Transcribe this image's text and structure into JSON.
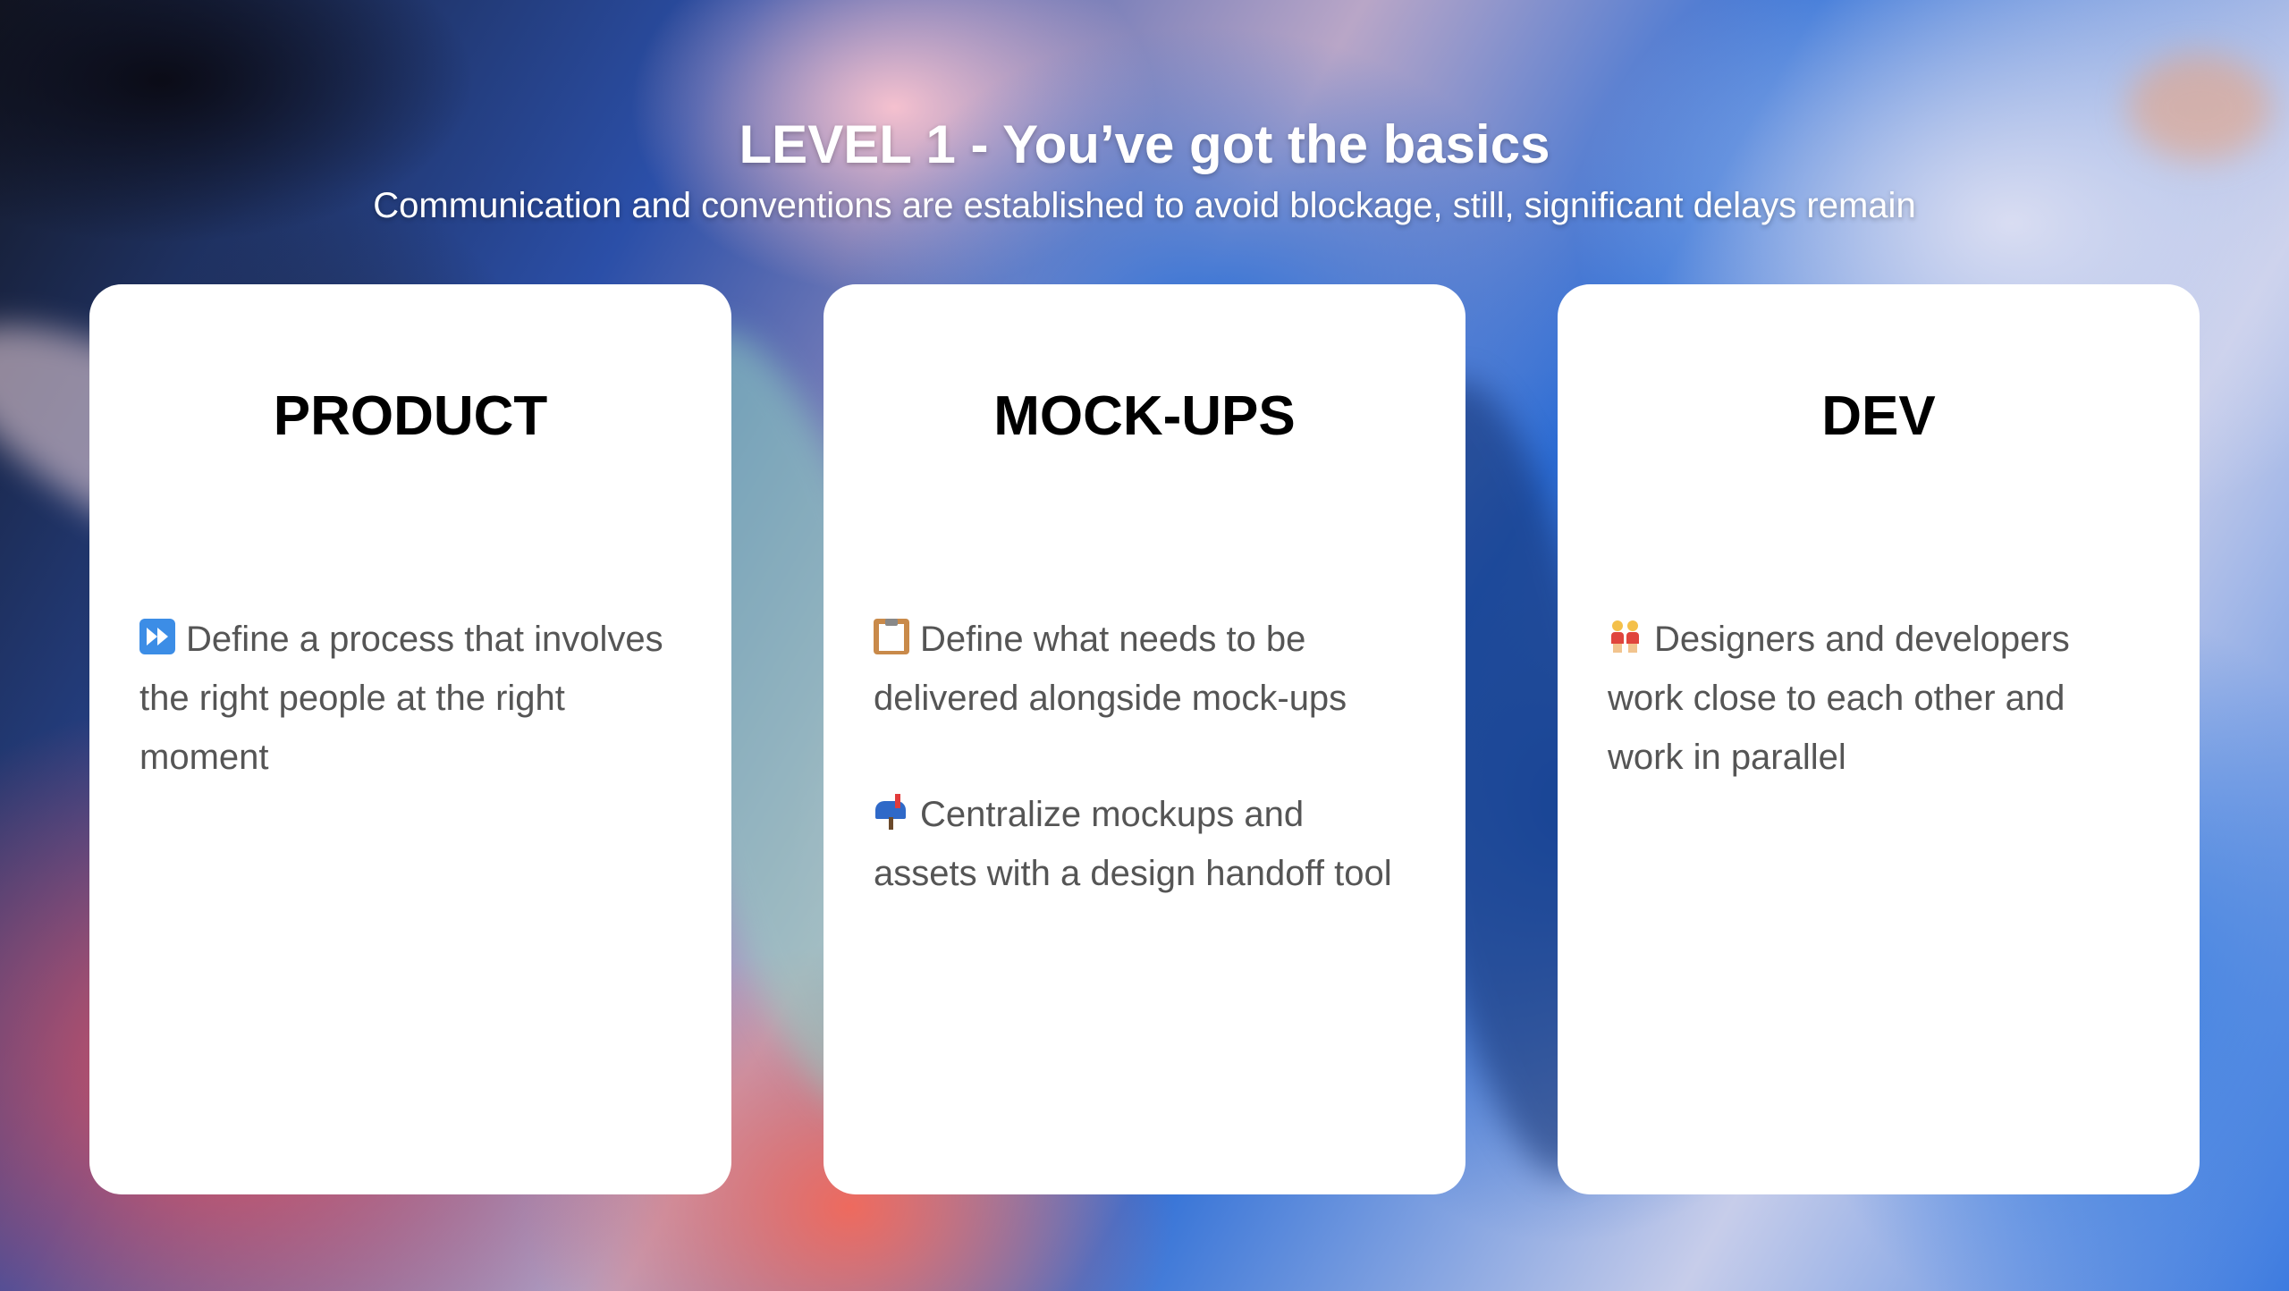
{
  "header": {
    "title": "LEVEL 1 - You’ve got the basics",
    "subtitle": "Communication and conventions are established to avoid blockage, still, significant delays remain"
  },
  "cards": [
    {
      "title": "PRODUCT",
      "items": [
        {
          "icon": "fast-forward-icon",
          "text": "Define a process that involves the right people at the right moment"
        }
      ]
    },
    {
      "title": "MOCK-UPS",
      "items": [
        {
          "icon": "clipboard-icon",
          "text": "Define what needs to be delivered alongside mock-ups"
        },
        {
          "icon": "mailbox-icon",
          "text": "Centralize mockups and assets with a design handoff tool"
        }
      ]
    },
    {
      "title": "DEV",
      "items": [
        {
          "icon": "two-people-icon",
          "text": "Designers and developers work close to each other and work in parallel"
        }
      ]
    }
  ],
  "colors": {
    "card_background": "#ffffff",
    "card_title": "#000000",
    "card_text": "#555555",
    "header_text": "#ffffff"
  }
}
